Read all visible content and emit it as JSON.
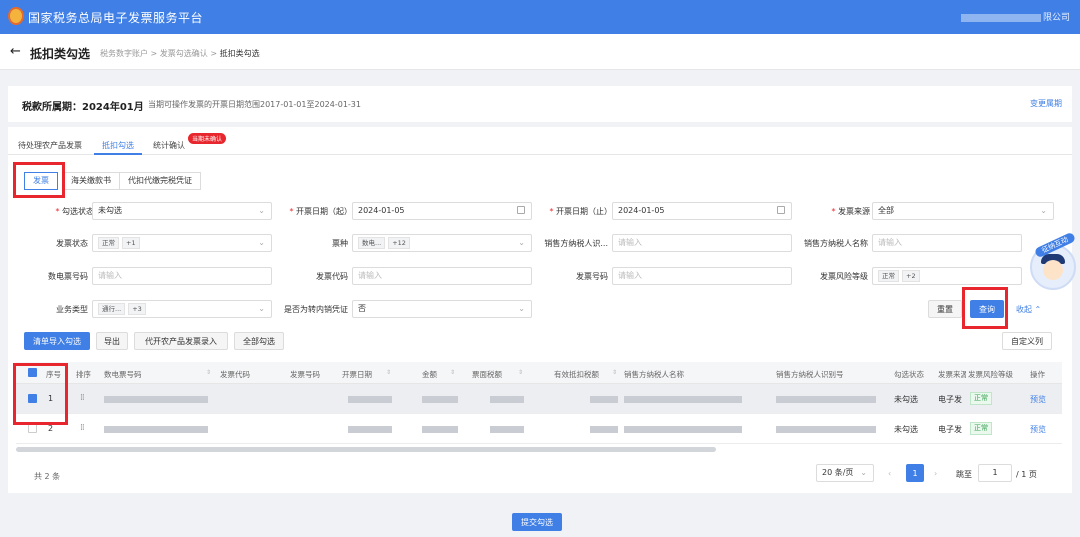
{
  "app": {
    "title": "国家税务总局电子发票服务平台",
    "user_suffix": "限公司"
  },
  "page": {
    "back": "←",
    "title": "抵扣类勾选",
    "breadcrumb": [
      "税务数字账户",
      "发票勾选确认",
      "抵扣类勾选"
    ]
  },
  "period": {
    "label": "税款所属期：2024年01月",
    "hint": "当期可操作发票的开票日期范围2017-01-01至2024-01-31",
    "change": "变更属期"
  },
  "tabs": [
    {
      "label": "待处理农产品发票"
    },
    {
      "label": "抵扣勾选"
    },
    {
      "label": "统计确认"
    }
  ],
  "tab_badge": "当期未确认",
  "subtabs": [
    "发票",
    "海关缴款书",
    "代扣代缴完税凭证"
  ],
  "filters": {
    "select_status": {
      "label": "勾选状态",
      "value": "未勾选"
    },
    "date_start": {
      "label": "开票日期（起）",
      "value": "2024-01-05"
    },
    "date_end": {
      "label": "开票日期（止）",
      "value": "2024-01-05"
    },
    "source": {
      "label": "发票来源",
      "value": "全部"
    },
    "invoice_status": {
      "label": "发票状态",
      "tags": [
        "正常",
        "+1"
      ]
    },
    "invoice_type": {
      "label": "票种",
      "tags": [
        "数电...",
        "+12"
      ]
    },
    "seller_tax_id": {
      "label": "销售方纳税人识...",
      "placeholder": "请输入"
    },
    "seller_name": {
      "label": "销售方纳税人名称",
      "placeholder": "请输入"
    },
    "digital_no": {
      "label": "数电票号码",
      "placeholder": "请输入"
    },
    "invoice_code": {
      "label": "发票代码",
      "placeholder": "请输入"
    },
    "invoice_no": {
      "label": "发票号码",
      "placeholder": "请输入"
    },
    "risk_level": {
      "label": "发票风险等级",
      "tags": [
        "正常",
        "+2"
      ]
    },
    "business_type": {
      "label": "业务类型",
      "tags": [
        "通行...",
        "+3"
      ]
    },
    "transfer_out": {
      "label": "是否为转内销凭证",
      "value": "否"
    }
  },
  "actions": {
    "reset": "重置",
    "query": "查询",
    "collapse": "收起 ⌃",
    "import": "清单导入勾选",
    "export": "导出",
    "agri_entry": "代开农产品发票录入",
    "select_all": "全部勾选",
    "custom_cols": "自定义列"
  },
  "table": {
    "headers": [
      "序号",
      "排序",
      "数电票号码",
      "发票代码",
      "发票号码",
      "开票日期",
      "金额",
      "票面税额",
      "有效抵扣税额",
      "销售方纳税人名称",
      "销售方纳税人识别号",
      "勾选状态",
      "发票来源",
      "发票风险等级",
      "操作"
    ],
    "rows": [
      {
        "index": "1",
        "status": "未勾选",
        "source": "电子发",
        "risk": "正常",
        "action": "预览",
        "checked": true
      },
      {
        "index": "2",
        "status": "未勾选",
        "source": "电子发",
        "risk": "正常",
        "action": "预览",
        "checked": false
      }
    ]
  },
  "footer": {
    "total": "共 2 条",
    "page_size": "20 条/页",
    "current_page": "1",
    "jump_label": "跳至",
    "jump_value": "1",
    "page_total": "/ 1 页"
  },
  "submit": "提交勾选",
  "assistant": {
    "label": "征纳互动"
  },
  "colors": {
    "primary": "#3f7fe6",
    "highlight": "#e8262d"
  }
}
